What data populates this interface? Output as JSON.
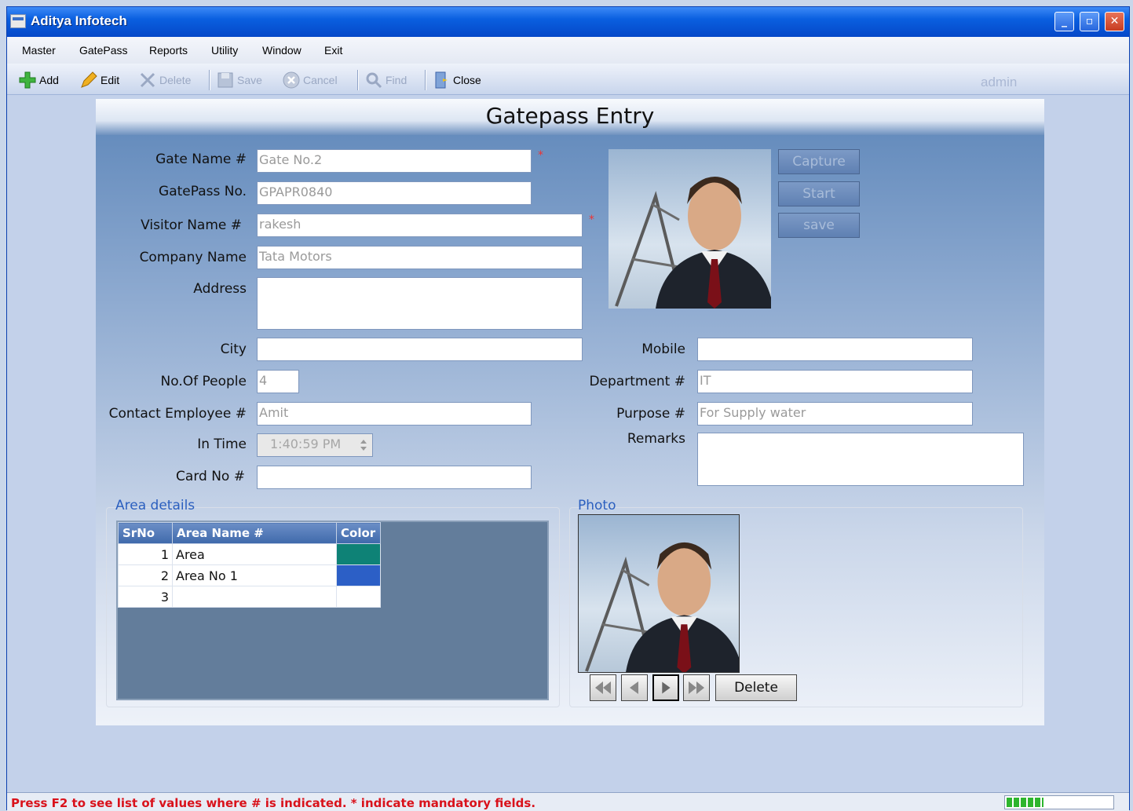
{
  "window": {
    "title": "Aditya Infotech",
    "min": "_",
    "max": "▫",
    "close": "✕"
  },
  "menu": [
    "Master",
    "GatePass",
    "Reports",
    "Utility",
    "Window",
    "Exit"
  ],
  "toolbar": {
    "add": "Add",
    "edit": "Edit",
    "delete": "Delete",
    "save": "Save",
    "cancel": "Cancel",
    "find": "Find",
    "close": "Close",
    "user": "admin"
  },
  "form": {
    "title": "Gatepass Entry",
    "gate_name": {
      "label": "Gate Name #",
      "value": "Gate No.2"
    },
    "gatepass_no": {
      "label": "GatePass No.",
      "value": "GPAPR0840"
    },
    "visitor_name": {
      "label": "Visitor Name #",
      "value": "rakesh"
    },
    "company_name": {
      "label": "Company Name",
      "value": "Tata Motors"
    },
    "address": {
      "label": "Address",
      "value": ""
    },
    "city": {
      "label": "City",
      "value": ""
    },
    "no_of_people": {
      "label": "No.Of People",
      "value": "4"
    },
    "contact_employee": {
      "label": "Contact Employee  #",
      "value": "Amit"
    },
    "in_time": {
      "label": "In Time",
      "value": "1:40:59 PM"
    },
    "card_no": {
      "label": "Card No #",
      "value": ""
    },
    "mobile": {
      "label": "Mobile",
      "value": ""
    },
    "department": {
      "label": "Department #",
      "value": "IT"
    },
    "purpose": {
      "label": "Purpose #",
      "value": "For Supply water"
    },
    "remarks": {
      "label": "Remarks",
      "value": ""
    },
    "mandatory": "*",
    "buttons": {
      "capture": "Capture",
      "start": "Start",
      "save": "save",
      "delete": "Delete"
    }
  },
  "area_details": {
    "title": "Area details",
    "columns": [
      "SrNo",
      "Area Name #",
      "Color"
    ],
    "rows": [
      {
        "srno": "1",
        "name": "Area",
        "color": "#0e8276"
      },
      {
        "srno": "2",
        "name": "Area No 1",
        "color": "#2c5fc6"
      },
      {
        "srno": "3",
        "name": "",
        "color": ""
      }
    ]
  },
  "photo_section": {
    "title": "Photo"
  },
  "status": {
    "text": "Press F2 to see list of values where # is indicated.  * indicate mandatory fields.",
    "progress": 0.35
  }
}
